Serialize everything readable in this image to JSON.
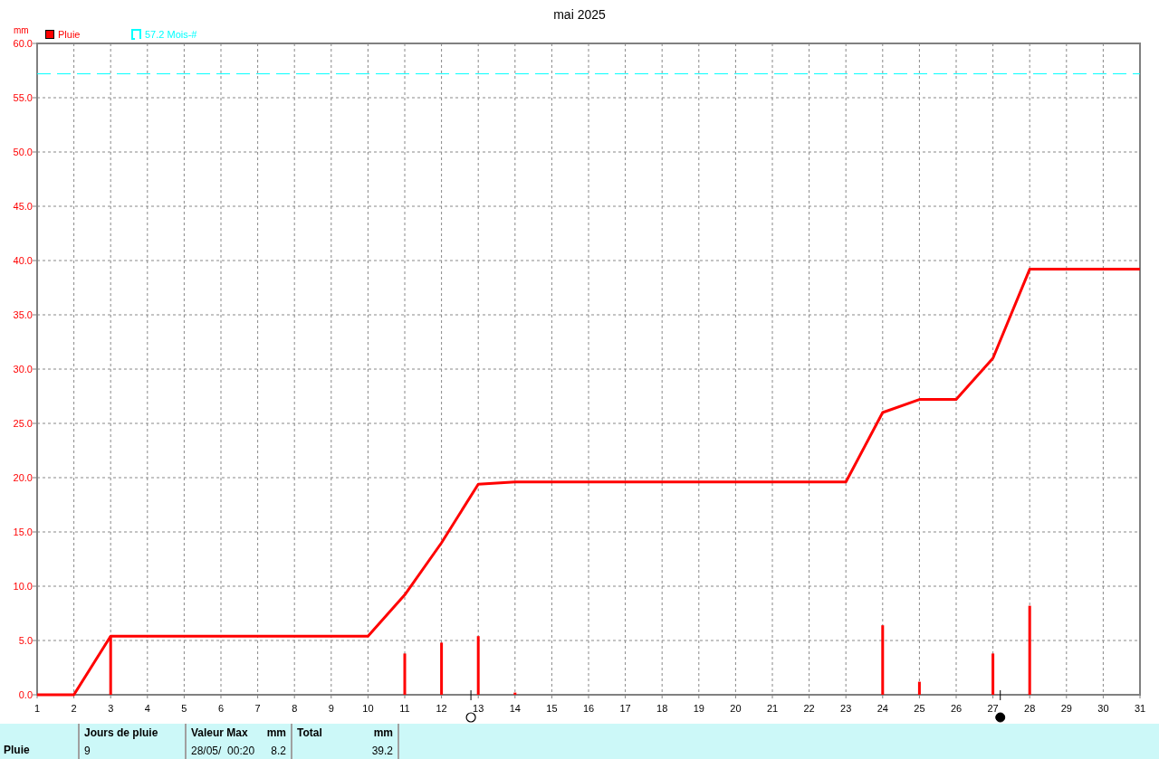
{
  "title": "mai 2025",
  "chart": {
    "moon_markers": [
      {
        "kind": "full"
      },
      {
        "kind": "new"
      }
    ],
    "chart_data": {
      "type": "bar",
      "ylabel": "mm",
      "xlim": [
        1,
        31
      ],
      "ylim": [
        0,
        60
      ],
      "x": [
        1,
        2,
        3,
        4,
        5,
        6,
        7,
        8,
        9,
        10,
        11,
        12,
        13,
        14,
        15,
        16,
        17,
        18,
        19,
        20,
        21,
        22,
        23,
        24,
        25,
        26,
        27,
        28,
        29,
        30,
        31
      ],
      "series": [
        {
          "name": "Pluie",
          "color": "#ff0000",
          "values": [
            0,
            0,
            5.4,
            0,
            0,
            0,
            0,
            0,
            0,
            0,
            3.8,
            4.8,
            5.4,
            0.2,
            0,
            0,
            0,
            0,
            0,
            0,
            0,
            0,
            0,
            6.4,
            1.2,
            0,
            3.8,
            8.2,
            0,
            0,
            0
          ]
        },
        {
          "name": "57.2 Mois-#",
          "type": "line",
          "line_style": "dashed",
          "color": "#00ffff",
          "values": [
            57.2,
            57.2,
            57.2,
            57.2,
            57.2,
            57.2,
            57.2,
            57.2,
            57.2,
            57.2,
            57.2,
            57.2,
            57.2,
            57.2,
            57.2,
            57.2,
            57.2,
            57.2,
            57.2,
            57.2,
            57.2,
            57.2,
            57.2,
            57.2,
            57.2,
            57.2,
            57.2,
            57.2,
            57.2,
            57.2,
            57.2
          ]
        },
        {
          "type": "line",
          "color": "#ff0000",
          "values": [
            0,
            0,
            5.4,
            5.4,
            5.4,
            5.4,
            5.4,
            5.4,
            5.4,
            5.4,
            9.2,
            14.0,
            19.4,
            19.6,
            19.6,
            19.6,
            19.6,
            19.6,
            19.6,
            19.6,
            19.6,
            19.6,
            19.6,
            26.0,
            27.2,
            27.2,
            31.0,
            39.2,
            39.2,
            39.2,
            39.2
          ]
        }
      ],
      "xticks": [
        1,
        2,
        3,
        4,
        5,
        6,
        7,
        8,
        9,
        10,
        11,
        12,
        13,
        14,
        15,
        16,
        17,
        18,
        19,
        20,
        21,
        22,
        23,
        24,
        25,
        26,
        27,
        28,
        29,
        30,
        31
      ],
      "yticks": [
        {
          "value": 0,
          "label": "0.0"
        },
        {
          "value": 5,
          "label": "5.0"
        },
        {
          "value": 10,
          "label": "10.0"
        },
        {
          "value": 15,
          "label": "15.0"
        },
        {
          "value": 20,
          "label": "20.0"
        },
        {
          "value": 25,
          "label": "25.0"
        },
        {
          "value": 30,
          "label": "30.0"
        },
        {
          "value": 35,
          "label": "35.0"
        },
        {
          "value": 40,
          "label": "40.0"
        },
        {
          "value": 45,
          "label": "45.0"
        },
        {
          "value": 50,
          "label": "50.0"
        },
        {
          "value": 55,
          "label": "55.0"
        },
        {
          "value": 60,
          "label": "60.0"
        }
      ],
      "grid": true,
      "legend": "upper left"
    }
  },
  "summary": {
    "columns": [
      {
        "heading": "Jours de pluie"
      },
      {
        "heading": "Valeur Max",
        "unit": "mm"
      },
      {
        "heading": "Total",
        "unit": "mm"
      }
    ],
    "rows": [
      {
        "label": "Pluie",
        "cells": [
          {
            "text": "9"
          },
          {
            "text": "28/05/  00:20",
            "value": "8.2"
          },
          {
            "value": "39.2"
          }
        ]
      }
    ]
  }
}
